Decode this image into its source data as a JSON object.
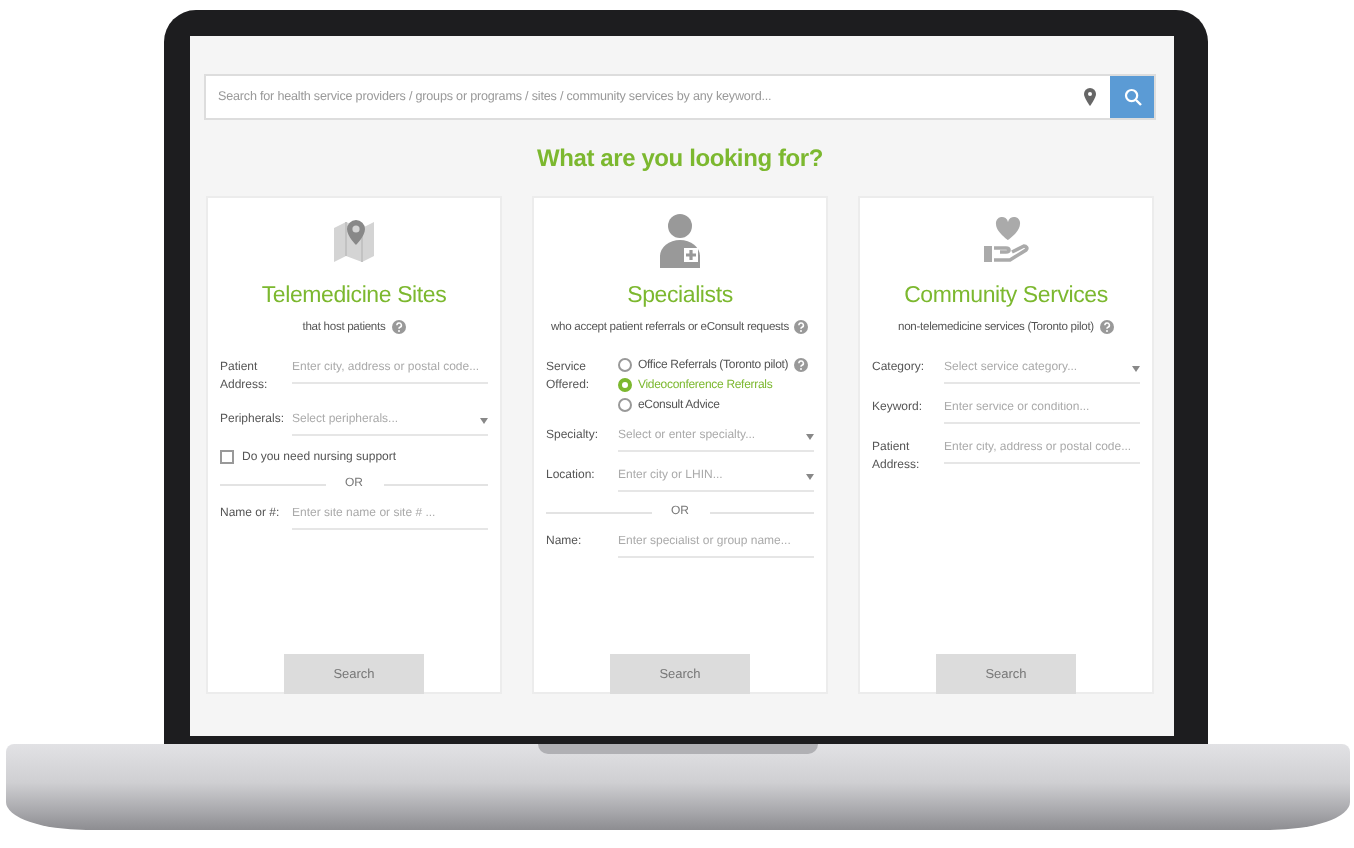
{
  "search": {
    "placeholder": "Search for health service providers / groups or programs / sites / community services by any keyword..."
  },
  "heading": "What are you looking for?",
  "cards": [
    {
      "title": "Telemedicine Sites",
      "subtitle": "that host patients",
      "has_info": true,
      "fields": [
        {
          "kind": "text",
          "label": "Patient Address:",
          "placeholder": "Enter city, address or postal code..."
        },
        {
          "kind": "select",
          "label": "Peripherals:",
          "placeholder": "Select peripherals..."
        },
        {
          "kind": "checkbox",
          "label": "Do you need nursing support",
          "checked": false
        },
        {
          "kind": "divider",
          "label": "OR"
        },
        {
          "kind": "text",
          "label": "Name or #:",
          "placeholder": "Enter site name or site # ..."
        }
      ],
      "button": "Search"
    },
    {
      "title": "Specialists",
      "subtitle": "who accept patient referrals or eConsult requests",
      "has_info": true,
      "fields": [
        {
          "kind": "radio",
          "label": "Service Offered:",
          "options": [
            {
              "label": "Office Referrals (Toronto pilot)",
              "selected": false,
              "has_info": true
            },
            {
              "label": "Videoconference Referrals",
              "selected": true,
              "has_info": false
            },
            {
              "label": "eConsult Advice",
              "selected": false,
              "has_info": false
            }
          ]
        },
        {
          "kind": "select",
          "label": "Specialty:",
          "placeholder": "Select or enter specialty..."
        },
        {
          "kind": "select",
          "label": "Location:",
          "placeholder": "Enter city or LHIN..."
        },
        {
          "kind": "divider",
          "label": "OR"
        },
        {
          "kind": "text",
          "label": "Name:",
          "placeholder": "Enter specialist or group name..."
        }
      ],
      "button": "Search"
    },
    {
      "title": "Community Services",
      "subtitle": "non-telemedicine services (Toronto pilot)",
      "has_info": true,
      "fields": [
        {
          "kind": "select",
          "label": "Category:",
          "placeholder": "Select service category..."
        },
        {
          "kind": "text",
          "label": "Keyword:",
          "placeholder": "Enter service or condition..."
        },
        {
          "kind": "text",
          "label": "Patient Address:",
          "placeholder": "Enter city, address or postal code..."
        }
      ],
      "button": "Search"
    }
  ]
}
